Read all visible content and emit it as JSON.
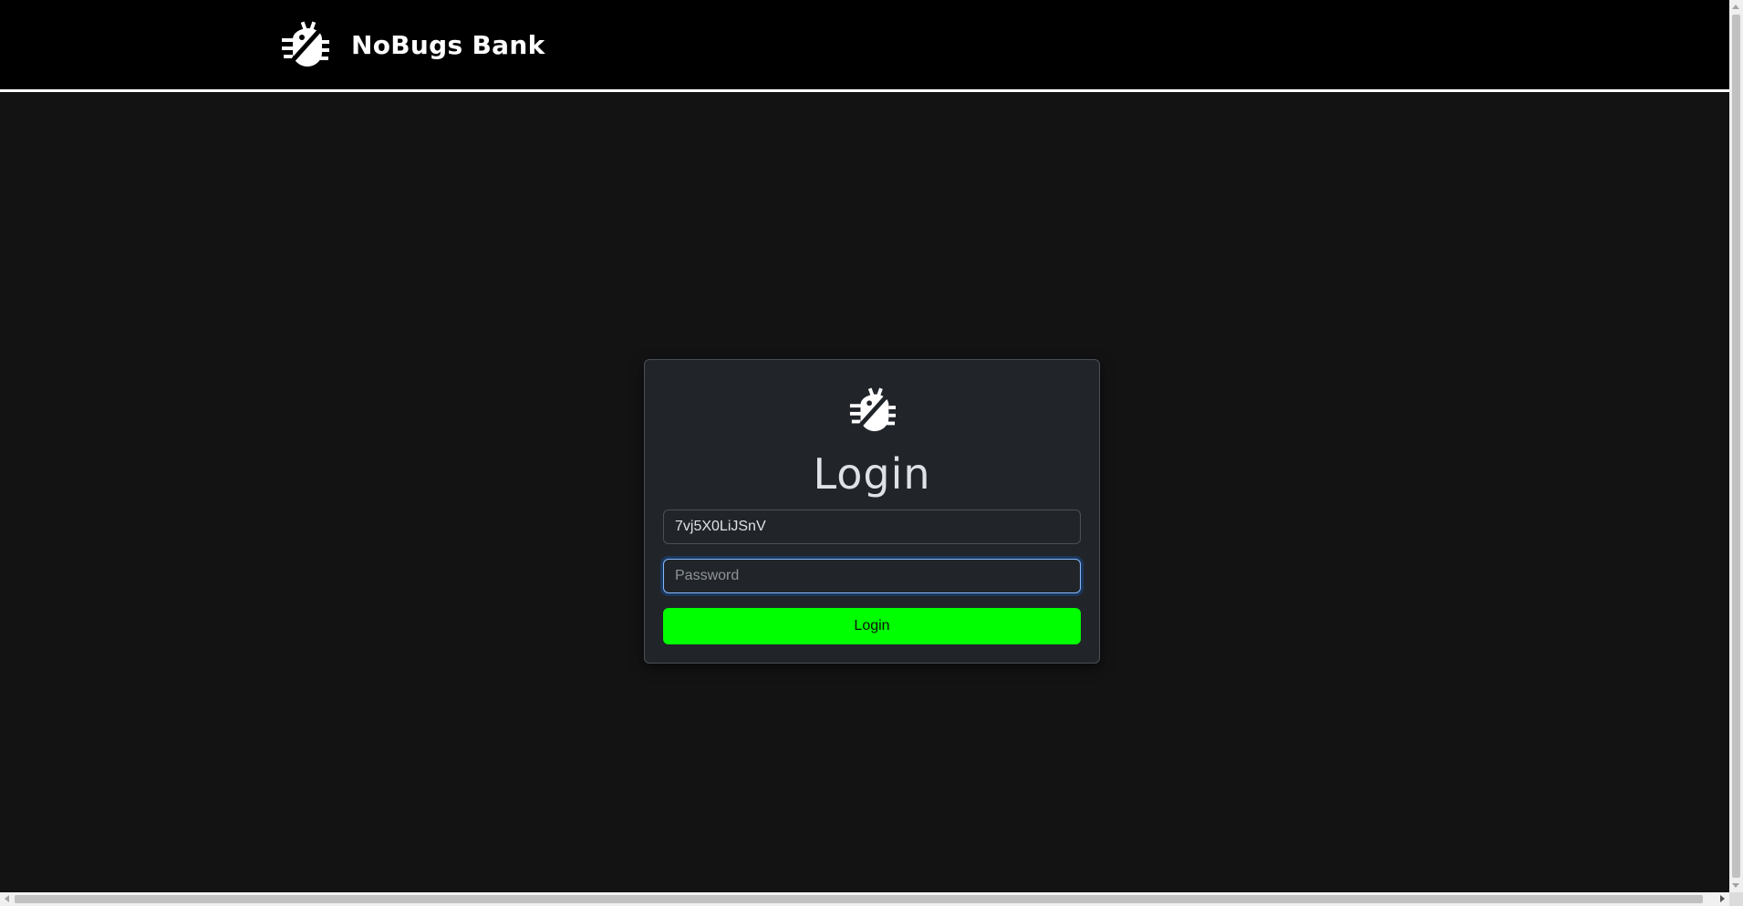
{
  "navbar": {
    "brand_name": "NoBugs Bank",
    "logo_icon": "bug-slash-icon"
  },
  "login": {
    "logo_icon": "bug-slash-icon",
    "title": "Login",
    "username_value": "7vj5X0LiJSnV",
    "password_placeholder": "Password",
    "button_label": "Login"
  },
  "colors": {
    "navbar_background": "#000000",
    "page_background": "#131313",
    "card_background": "#212529",
    "button_accent": "#00ff00",
    "focus_border": "#86b7fe"
  }
}
